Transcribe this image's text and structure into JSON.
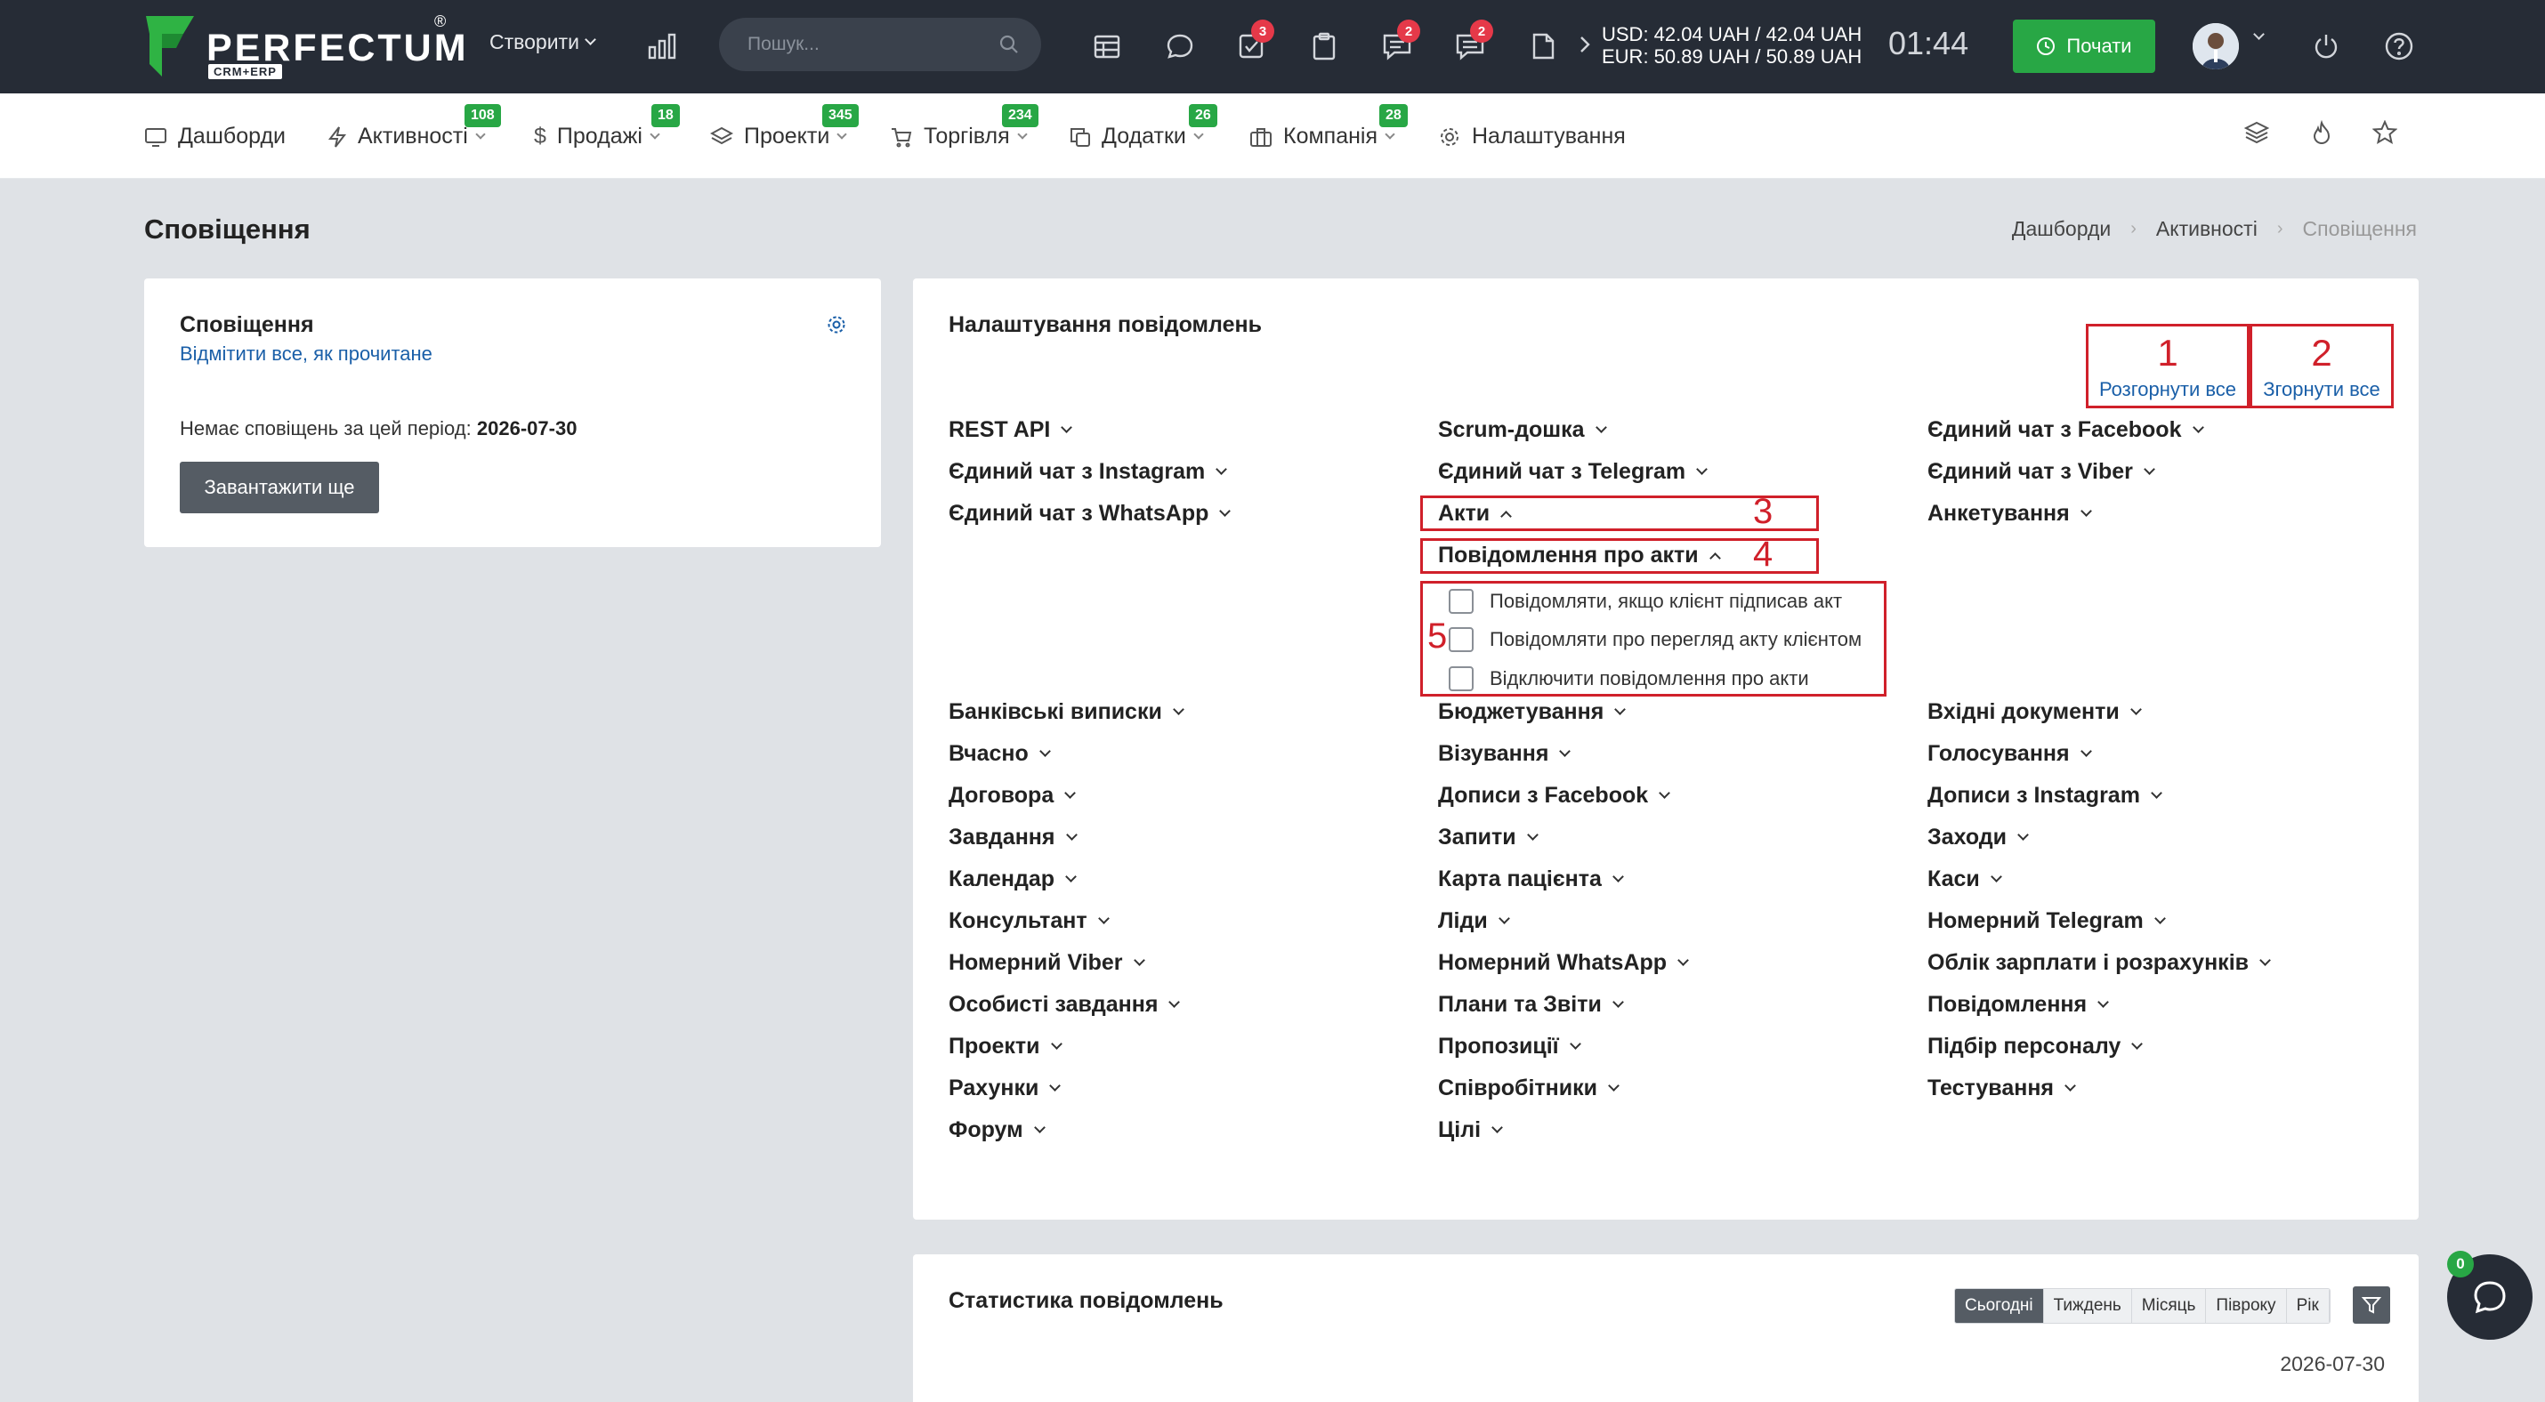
{
  "brand": {
    "name": "PERFECTUM",
    "reg": "®",
    "sub": "CRM+ERP"
  },
  "header": {
    "create_label": "Створити",
    "search_placeholder": "Пошук...",
    "badges": {
      "tasks": "3",
      "chat": "2",
      "messages": "2"
    },
    "rates_line1": "USD: 42.04 UAH / 42.04 UAH",
    "rates_line2": "EUR: 50.89 UAH / 50.89 UAH",
    "clock": "01:44",
    "start_label": "Почати"
  },
  "nav": {
    "items": [
      {
        "label": "Дашборди",
        "badge": ""
      },
      {
        "label": "Активності",
        "badge": "108"
      },
      {
        "label": "Продажі",
        "badge": "18"
      },
      {
        "label": "Проекти",
        "badge": "345"
      },
      {
        "label": "Торгівля",
        "badge": "234"
      },
      {
        "label": "Додатки",
        "badge": "26"
      },
      {
        "label": "Компанія",
        "badge": "28"
      },
      {
        "label": "Налаштування",
        "badge": ""
      }
    ]
  },
  "page": {
    "title": "Сповіщення",
    "breadcrumb": [
      "Дашборди",
      "Активності",
      "Сповіщення"
    ]
  },
  "notifications_card": {
    "title": "Сповіщення",
    "mark_all": "Відмітити все, як прочитане",
    "empty_text": "Немає сповіщень за цей період:",
    "empty_date": "2026-07-30",
    "load_more": "Завантажити ще"
  },
  "settings_card": {
    "title": "Налаштування повідомлень",
    "expand_num": "1",
    "expand_label": "Розгорнути все",
    "collapse_num": "2",
    "collapse_label": "Згорнути все",
    "markers": {
      "acts": "3",
      "acts_notif": "4",
      "options": "5"
    },
    "col1_top": [
      "REST API",
      "Єдиний чат з Instagram",
      "Єдиний чат з WhatsApp"
    ],
    "col2_top": [
      "Scrum-дошка",
      "Єдиний чат з Telegram"
    ],
    "col3_top": [
      "Єдиний чат з Facebook",
      "Єдиний чат з Viber",
      "Анкетування"
    ],
    "acts": "Акти",
    "acts_notif": "Повідомлення про акти",
    "options": [
      "Повідомляти, якщо клієнт підписав акт",
      "Повідомляти про перегляд акту клієнтом",
      "Відключити повідомлення про акти"
    ],
    "col1": [
      "Банківські виписки",
      "Вчасно",
      "Договора",
      "Завдання",
      "Календар",
      "Консультант",
      "Номерний Viber",
      "Особисті завдання",
      "Проекти",
      "Рахунки",
      "Форум"
    ],
    "col2": [
      "Бюджетування",
      "Візування",
      "Дописи з Facebook",
      "Запити",
      "Карта пацієнта",
      "Ліди",
      "Номерний WhatsApp",
      "Плани та Звіти",
      "Пропозиції",
      "Співробітники",
      "Цілі"
    ],
    "col3": [
      "Вхідні документи",
      "Голосування",
      "Дописи з Instagram",
      "Заходи",
      "Каси",
      "Номерний Telegram",
      "Облік зарплати і розрахунків",
      "Повідомлення",
      "Підбір персоналу",
      "Тестування"
    ]
  },
  "stats_card": {
    "title": "Статистика повідомлень",
    "periods": [
      "Сьогодні",
      "Тиждень",
      "Місяць",
      "Півроку",
      "Рік"
    ],
    "date": "2026-07-30"
  },
  "chat": {
    "badge": "0"
  }
}
